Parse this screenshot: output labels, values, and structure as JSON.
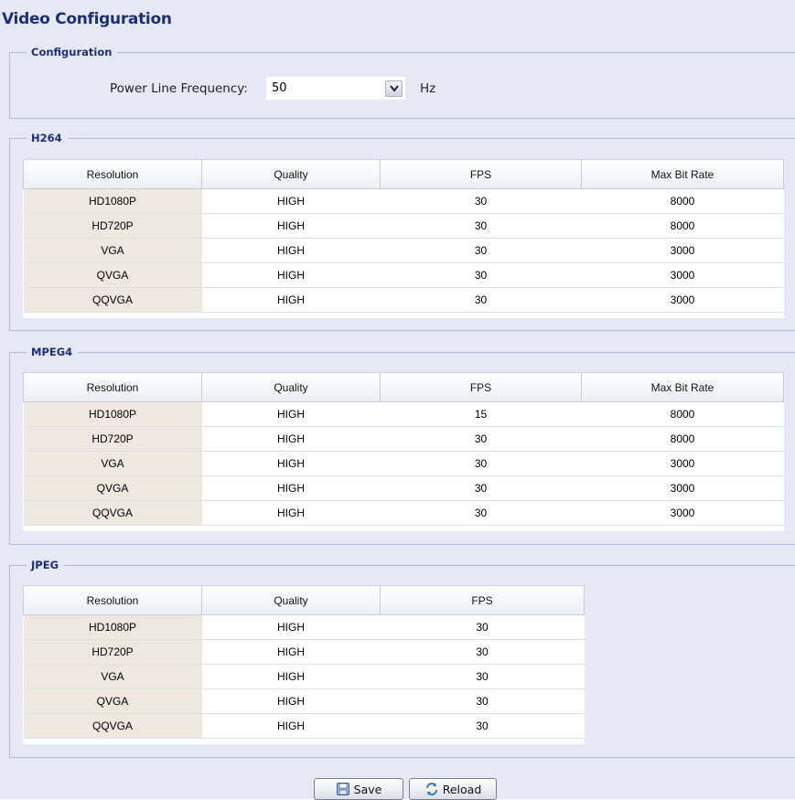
{
  "page": {
    "title": "Video Configuration"
  },
  "configuration": {
    "legend": "Configuration",
    "power_line_label": "Power Line Frequency:",
    "power_line_value": "50",
    "power_line_unit": "Hz"
  },
  "h264": {
    "legend": "H264",
    "headers": [
      "Resolution",
      "Quality",
      "FPS",
      "Max Bit Rate"
    ],
    "rows": [
      [
        "HD1080P",
        "HIGH",
        "30",
        "8000"
      ],
      [
        "HD720P",
        "HIGH",
        "30",
        "8000"
      ],
      [
        "VGA",
        "HIGH",
        "30",
        "3000"
      ],
      [
        "QVGA",
        "HIGH",
        "30",
        "3000"
      ],
      [
        "QQVGA",
        "HIGH",
        "30",
        "3000"
      ]
    ]
  },
  "mpeg4": {
    "legend": "MPEG4",
    "headers": [
      "Resolution",
      "Quality",
      "FPS",
      "Max Bit Rate"
    ],
    "rows": [
      [
        "HD1080P",
        "HIGH",
        "15",
        "8000"
      ],
      [
        "HD720P",
        "HIGH",
        "30",
        "8000"
      ],
      [
        "VGA",
        "HIGH",
        "30",
        "3000"
      ],
      [
        "QVGA",
        "HIGH",
        "30",
        "3000"
      ],
      [
        "QQVGA",
        "HIGH",
        "30",
        "3000"
      ]
    ]
  },
  "jpeg": {
    "legend": "JPEG",
    "headers": [
      "Resolution",
      "Quality",
      "FPS"
    ],
    "rows": [
      [
        "HD1080P",
        "HIGH",
        "30"
      ],
      [
        "HD720P",
        "HIGH",
        "30"
      ],
      [
        "VGA",
        "HIGH",
        "30"
      ],
      [
        "QVGA",
        "HIGH",
        "30"
      ],
      [
        "QQVGA",
        "HIGH",
        "30"
      ]
    ]
  },
  "buttons": {
    "save_label": "Save",
    "reload_label": "Reload"
  },
  "icons": {
    "save": "save-icon",
    "reload": "reload-icon",
    "dropdown": "chevron-down-icon"
  },
  "colors": {
    "title": "#1c2f78",
    "background": "#e6e9f5",
    "resolution_cell": "#ede8e0"
  }
}
